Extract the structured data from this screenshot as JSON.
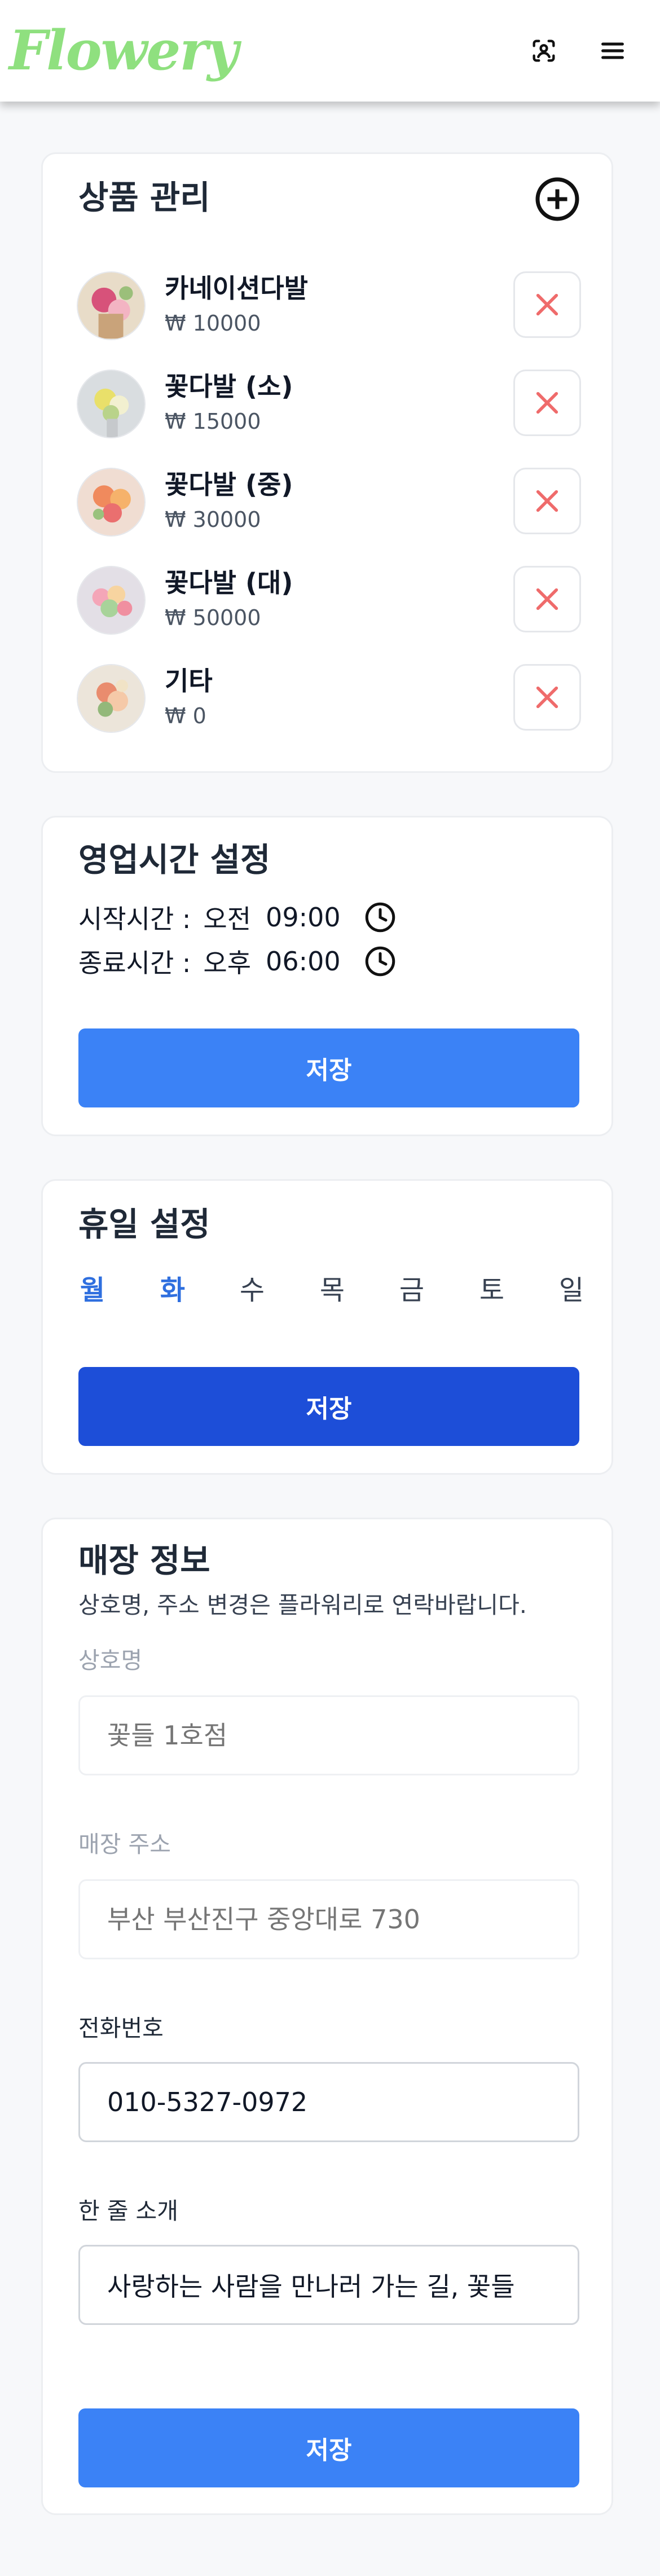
{
  "app": {
    "logo_text": "Flowery"
  },
  "header": {
    "scan_icon": "scan-icon",
    "menu_icon": "hamburger-menu-icon"
  },
  "products": {
    "title": "상품 관리",
    "add_icon": "plus-circle-icon",
    "delete_icon": "x-icon",
    "items": [
      {
        "name": "카네이션다발",
        "price": "₩ 10000"
      },
      {
        "name": "꽃다발 (소)",
        "price": "₩ 15000"
      },
      {
        "name": "꽃다발 (중)",
        "price": "₩ 30000"
      },
      {
        "name": "꽃다발 (대)",
        "price": "₩ 50000"
      },
      {
        "name": "기타",
        "price": "₩ 0"
      }
    ]
  },
  "hours": {
    "title": "영업시간 설정",
    "start_label": "시작시간 :",
    "start_ampm": "오전",
    "start_time": "09:00",
    "end_label": "종료시간 :",
    "end_ampm": "오후",
    "end_time": "06:00",
    "clock_icon": "clock-icon",
    "save_label": "저장"
  },
  "holidays": {
    "title": "휴일 설정",
    "days": [
      {
        "label": "월",
        "selected": true
      },
      {
        "label": "화",
        "selected": true
      },
      {
        "label": "수",
        "selected": false
      },
      {
        "label": "목",
        "selected": false
      },
      {
        "label": "금",
        "selected": false
      },
      {
        "label": "토",
        "selected": false
      },
      {
        "label": "일",
        "selected": false
      }
    ],
    "save_label": "저장"
  },
  "store": {
    "title": "매장 정보",
    "subtitle": "상호명, 주소 변경은 플라워리로 연락바랍니다.",
    "name_label": "상호명",
    "name_placeholder": "꽃들 1호점",
    "address_label": "매장 주소",
    "address_placeholder": "부산 부산진구 중앙대로 730",
    "phone_label": "전화번호",
    "phone_value": "010-5327-0972",
    "intro_label": "한 줄 소개",
    "intro_value": "사랑하는 사람을 만나러 가는 길, 꽃들",
    "save_label": "저장"
  },
  "colors": {
    "logo": "#8fe07f",
    "primary_button": "#3b82f6",
    "primary_button_dark": "#1d4ed8",
    "selected_day": "#2f6fdf",
    "delete_icon": "#ef6b6b"
  }
}
